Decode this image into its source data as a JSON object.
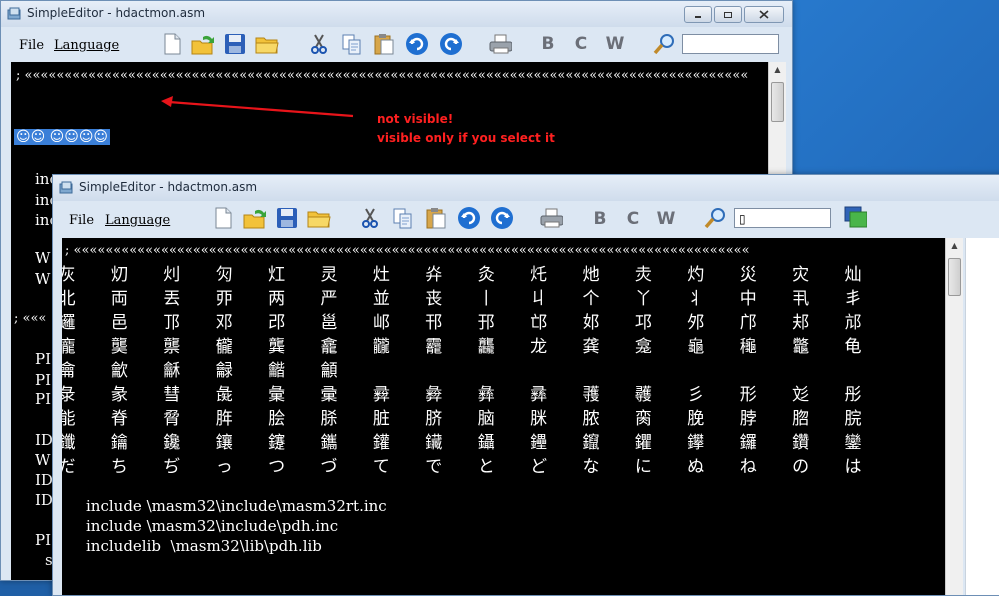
{
  "back_window": {
    "title": "SimpleEditor - hdactmon.asm",
    "menu": [
      "File",
      "Language"
    ],
    "toolbar_letters": [
      "B",
      "C",
      "W"
    ],
    "search_value": "",
    "comment_line": "; «««««««««««««««««««««««««««««««««««««««««««««««««««««««««««««««««««««««««««««««««««««««««««",
    "selected_text": "☺☺ ☺☺☺☺",
    "left_fragments": [
      "inc",
      "inc",
      "inc",
      "W",
      "W",
      "; «««",
      "PI",
      "PI",
      "PI",
      "ID",
      "W",
      "ID",
      "ID",
      "PI",
      "s"
    ]
  },
  "annotation": {
    "line1": "not visible!",
    "line2": "visible only if you select it"
  },
  "front_window": {
    "title": "SimpleEditor - hdactmon.asm",
    "menu": [
      "File",
      "Language"
    ],
    "toolbar_letters": [
      "B",
      "C",
      "W"
    ],
    "search_value": "▯",
    "comment_line": "; «««««««««««««««««««««««««««««««««««««««««««««««««««««««««««««««««««««««««««««««««««««",
    "cjk_rows": [
      [
        "灰",
        "灱",
        "灲",
        "灳",
        "灴",
        "灵",
        "灶",
        "灷",
        "灸",
        "灹",
        "灺",
        "灻",
        "灼",
        "災",
        "灾",
        "灿"
      ],
      [
        "北",
        "両",
        "丟",
        "丣",
        "两",
        "严",
        "並",
        "丧",
        "丨",
        "丩",
        "个",
        "丫",
        "丬",
        "中",
        "丮",
        "丯"
      ],
      [
        "邏",
        "邑",
        "邒",
        "邓",
        "邔",
        "邕",
        "邖",
        "邗",
        "邘",
        "邙",
        "邚",
        "邛",
        "邜",
        "邝",
        "邞",
        "邟"
      ],
      [
        "龐",
        "龑",
        "龒",
        "龓",
        "龔",
        "龕",
        "龖",
        "龗",
        "龘",
        "龙",
        "龚",
        "龛",
        "龜",
        "龝",
        "龞",
        "龟"
      ],
      [
        "龠",
        "龡",
        "龢",
        "龣",
        "龤",
        "龥"
      ],
      [
        "彔",
        "彖",
        "彗",
        "彘",
        "彙",
        "彚",
        "彛",
        "彜",
        "彝",
        "彞",
        "彟",
        "彠",
        "彡",
        "形",
        "彣",
        "彤"
      ],
      [
        "能",
        "脊",
        "脋",
        "脌",
        "脍",
        "脎",
        "脏",
        "脐",
        "脑",
        "脒",
        "脓",
        "脔",
        "脕",
        "脖",
        "脗",
        "脘"
      ],
      [
        "鑯",
        "鑰",
        "鑱",
        "鑲",
        "鑳",
        "鑴",
        "鑵",
        "鑶",
        "鑷",
        "鑸",
        "鑹",
        "鑺",
        "鑻",
        "鑼",
        "鑽",
        "鑾"
      ],
      [
        "だ",
        "ち",
        "ぢ",
        "っ",
        "つ",
        "づ",
        "て",
        "で",
        "と",
        "ど",
        "な",
        "に",
        "ぬ",
        "ね",
        "の",
        "は"
      ]
    ],
    "code_lines": [
      "include \\masm32\\include\\masm32rt.inc",
      "include \\masm32\\include\\pdh.inc",
      "includelib  \\masm32\\lib\\pdh.lib"
    ]
  }
}
